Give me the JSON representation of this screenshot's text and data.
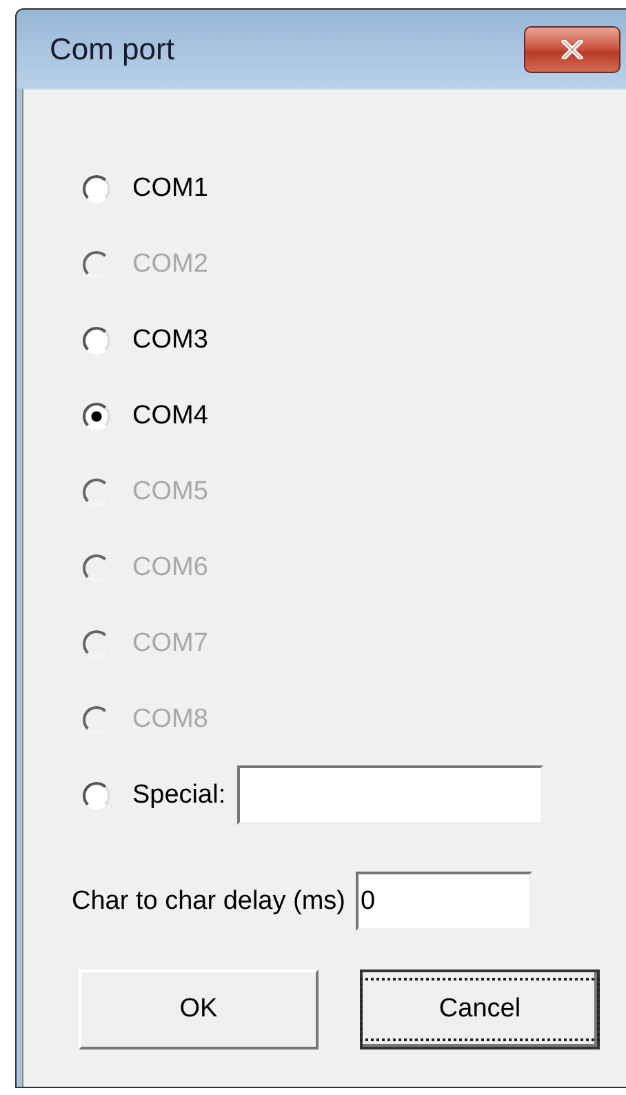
{
  "window": {
    "title": "Com port"
  },
  "ports": [
    {
      "kind": "radio",
      "label": "COM1",
      "selected": false,
      "disabled": false
    },
    {
      "kind": "radio",
      "label": "COM2",
      "selected": false,
      "disabled": true
    },
    {
      "kind": "radio",
      "label": "COM3",
      "selected": false,
      "disabled": false
    },
    {
      "kind": "radio",
      "label": "COM4",
      "selected": true,
      "disabled": false
    },
    {
      "kind": "radio",
      "label": "COM5",
      "selected": false,
      "disabled": true
    },
    {
      "kind": "radio",
      "label": "COM6",
      "selected": false,
      "disabled": true
    },
    {
      "kind": "radio",
      "label": "COM7",
      "selected": false,
      "disabled": true
    },
    {
      "kind": "radio",
      "label": "COM8",
      "selected": false,
      "disabled": true
    },
    {
      "kind": "special",
      "label": "Special:",
      "selected": false,
      "disabled": false
    }
  ],
  "delay": {
    "label": "Char to char delay (ms)",
    "value": "0"
  },
  "buttons": [
    {
      "label": "OK",
      "focused": false
    },
    {
      "label": "Cancel",
      "focused": true
    }
  ]
}
